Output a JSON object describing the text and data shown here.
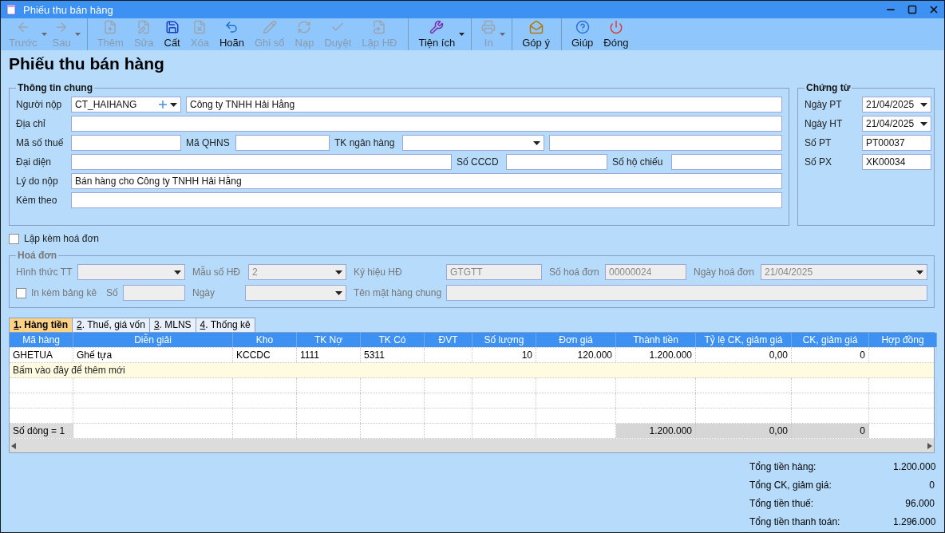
{
  "window": {
    "title": "Phiếu thu bán hàng"
  },
  "toolbar": [
    {
      "label": "Trước",
      "disabled": true,
      "dropdown": true,
      "separator_after": false
    },
    {
      "label": "Sau",
      "disabled": true,
      "dropdown": true,
      "separator_after": true
    },
    {
      "label": "Thêm",
      "disabled": true,
      "dropdown": false,
      "separator_after": false
    },
    {
      "label": "Sửa",
      "disabled": true,
      "dropdown": false,
      "separator_after": false
    },
    {
      "label": "Cất",
      "disabled": false,
      "dropdown": false,
      "separator_after": false
    },
    {
      "label": "Xóa",
      "disabled": true,
      "dropdown": false,
      "separator_after": false
    },
    {
      "label": "Hoãn",
      "disabled": false,
      "dropdown": false,
      "separator_after": false
    },
    {
      "label": "Ghi sổ",
      "disabled": true,
      "dropdown": false,
      "separator_after": false
    },
    {
      "label": "Nạp",
      "disabled": true,
      "dropdown": false,
      "separator_after": false
    },
    {
      "label": "Duyệt",
      "disabled": true,
      "dropdown": false,
      "separator_after": false
    },
    {
      "label": "Lập HĐ",
      "disabled": true,
      "dropdown": false,
      "separator_after": true
    },
    {
      "label": "Tiện ích",
      "disabled": false,
      "dropdown": true,
      "separator_after": true
    },
    {
      "label": "In",
      "disabled": true,
      "dropdown": true,
      "separator_after": true
    },
    {
      "label": "Góp ý",
      "disabled": false,
      "dropdown": false,
      "separator_after": true
    },
    {
      "label": "Giúp",
      "disabled": false,
      "dropdown": false,
      "separator_after": false
    },
    {
      "label": "Đóng",
      "disabled": false,
      "dropdown": false,
      "separator_after": false
    }
  ],
  "heading": "Phiếu thu bán hàng",
  "general": {
    "title": "Thông tin chung",
    "rows": [
      [
        {
          "kind": "label",
          "text": "Người nộp"
        },
        {
          "kind": "code",
          "value": "CT_HAIHANG"
        },
        {
          "kind": "field",
          "value": "Công ty TNHH Hải Hằng"
        }
      ],
      [
        {
          "kind": "label",
          "text": "Địa chỉ"
        },
        {
          "kind": "field"
        }
      ],
      [
        {
          "kind": "label",
          "text": "Mã số thuế"
        },
        {
          "kind": "field"
        },
        {
          "kind": "label",
          "text": "Mã QHNS"
        },
        {
          "kind": "field"
        },
        {
          "kind": "label",
          "text": "TK ngân hàng"
        },
        {
          "kind": "combo"
        },
        {
          "kind": "field"
        }
      ],
      [
        {
          "kind": "label",
          "text": "Đại diện"
        },
        {
          "kind": "field"
        },
        {
          "kind": "label",
          "text": "Số CCCD"
        },
        {
          "kind": "field"
        },
        {
          "kind": "label",
          "text": "Số hộ chiếu"
        },
        {
          "kind": "field"
        }
      ],
      [
        {
          "kind": "label",
          "text": "Lý do nộp"
        },
        {
          "kind": "field",
          "value": "Bán hàng cho Công ty TNHH Hải Hằng"
        }
      ],
      [
        {
          "kind": "label",
          "text": "Kèm theo"
        },
        {
          "kind": "field"
        }
      ]
    ]
  },
  "voucher": {
    "title": "Chứng từ",
    "rows": [
      {
        "label": "Ngày PT",
        "kind": "combo",
        "value": "21/04/2025"
      },
      {
        "label": "Ngày HT",
        "kind": "combo",
        "value": "21/04/2025"
      },
      {
        "label": "Số PT",
        "kind": "field",
        "value": "PT00037"
      },
      {
        "label": "Số PX",
        "kind": "field",
        "value": "XK00034"
      }
    ]
  },
  "with_invoice": {
    "label": "Lập kèm hoá đơn",
    "checked": false
  },
  "invoice": {
    "title": "Hoá đơn",
    "disabled": true,
    "rows": [
      [
        {
          "kind": "combo",
          "label": "Hình thức TT"
        },
        {
          "kind": "combo",
          "label": "Mẫu số HĐ",
          "value": "2"
        },
        {
          "kind": "field",
          "label": "Ký hiệu HĐ",
          "value": "GTGTT"
        },
        {
          "kind": "field",
          "label": "Số hoá đơn",
          "value": "00000024"
        },
        {
          "kind": "combo",
          "label": "Ngày hoá đơn",
          "value": "21/04/2025"
        }
      ],
      [
        {
          "kind": "checkbox",
          "label": "In kèm bảng kê",
          "checked": false,
          "field_label": "Số"
        },
        {
          "kind": "combo",
          "label": "Ngày"
        },
        {
          "kind": "field",
          "label": "Tên mặt hàng chung"
        }
      ]
    ]
  },
  "tabs": [
    {
      "label": "1. Hàng tiền",
      "selected": true
    },
    {
      "label": "2. Thuế, giá vốn",
      "selected": false
    },
    {
      "label": "3. MLNS",
      "selected": false
    },
    {
      "label": "4. Thống kê",
      "selected": false
    }
  ],
  "table": {
    "columns": [
      {
        "label": "Mã hàng",
        "kind": "text"
      },
      {
        "label": "Diễn giải",
        "kind": "text"
      },
      {
        "label": "Kho",
        "kind": "text"
      },
      {
        "label": "TK Nợ",
        "kind": "text"
      },
      {
        "label": "TK Có",
        "kind": "text"
      },
      {
        "label": "ĐVT"
      },
      {
        "label": "Số lượng",
        "kind": "number"
      },
      {
        "label": "Đơn giá",
        "kind": "number"
      },
      {
        "label": "Thành tiền",
        "kind": "number",
        "total": "1.200.000"
      },
      {
        "label": "Tỷ lệ CK, giảm giá",
        "kind": "number",
        "total": "0,00"
      },
      {
        "label": "CK, giảm giá",
        "kind": "number",
        "total": "0"
      },
      {
        "label": "Hợp đồng"
      }
    ],
    "rows": [
      [
        "GHETUA",
        "Ghế tựa",
        "KCCDC",
        "1111",
        "5311",
        null,
        "10",
        "120.000",
        "1.200.000",
        "0,00",
        "0",
        null
      ]
    ],
    "new_row_hint": "Bấm vào đây để thêm mới",
    "footer_label": "Số dòng = 1"
  },
  "totals": [
    {
      "label": "Tổng tiền hàng:",
      "value": "1.200.000"
    },
    {
      "label": "Tổng CK, giảm giá:",
      "value": "0"
    },
    {
      "label": "Tổng tiền thuế:",
      "value": "96.000"
    },
    {
      "label": "Tổng tiền thanh toán:",
      "value": "1.296.000"
    }
  ]
}
